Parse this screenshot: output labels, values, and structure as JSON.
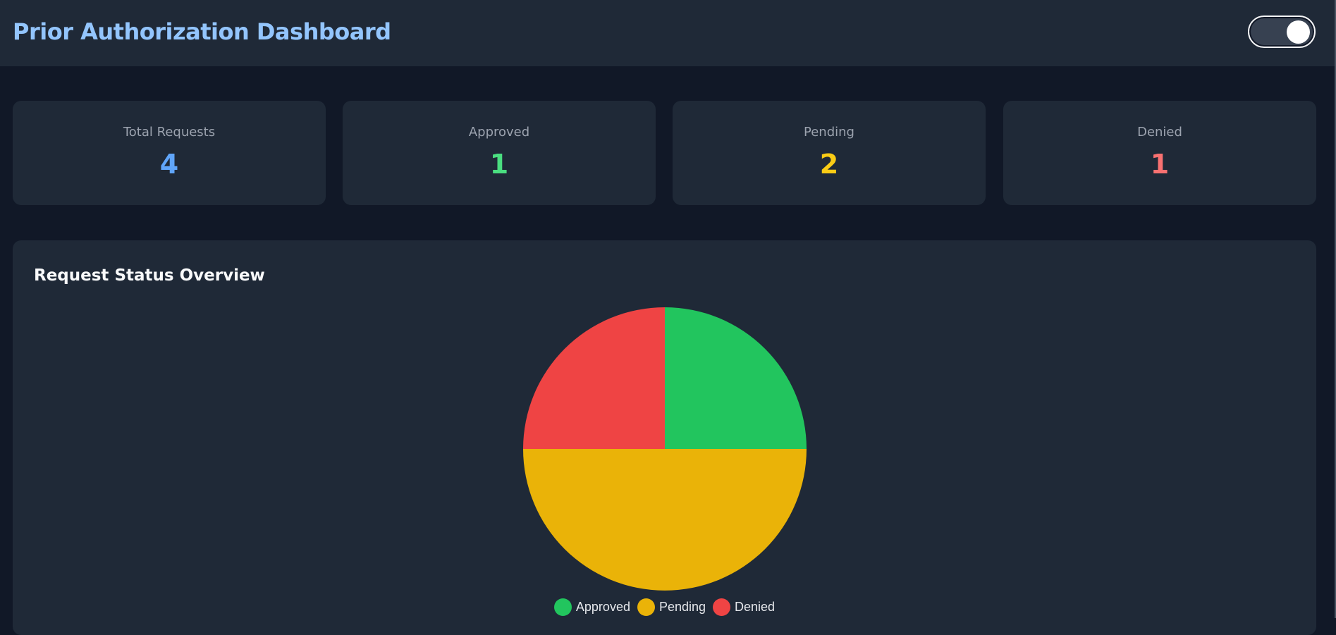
{
  "header": {
    "title": "Prior Authorization Dashboard",
    "theme_toggle_on": true
  },
  "stats": [
    {
      "label": "Total Requests",
      "value": "4",
      "color": "#60a5fa"
    },
    {
      "label": "Approved",
      "value": "1",
      "color": "#4ade80"
    },
    {
      "label": "Pending",
      "value": "2",
      "color": "#facc15"
    },
    {
      "label": "Denied",
      "value": "1",
      "color": "#f87171"
    }
  ],
  "chart_data": {
    "type": "pie",
    "title": "Request Status Overview",
    "categories": [
      "Approved",
      "Pending",
      "Denied"
    ],
    "values": [
      1,
      2,
      1
    ],
    "colors": [
      "#22c55e",
      "#eab308",
      "#ef4444"
    ],
    "legend": "bottom"
  }
}
